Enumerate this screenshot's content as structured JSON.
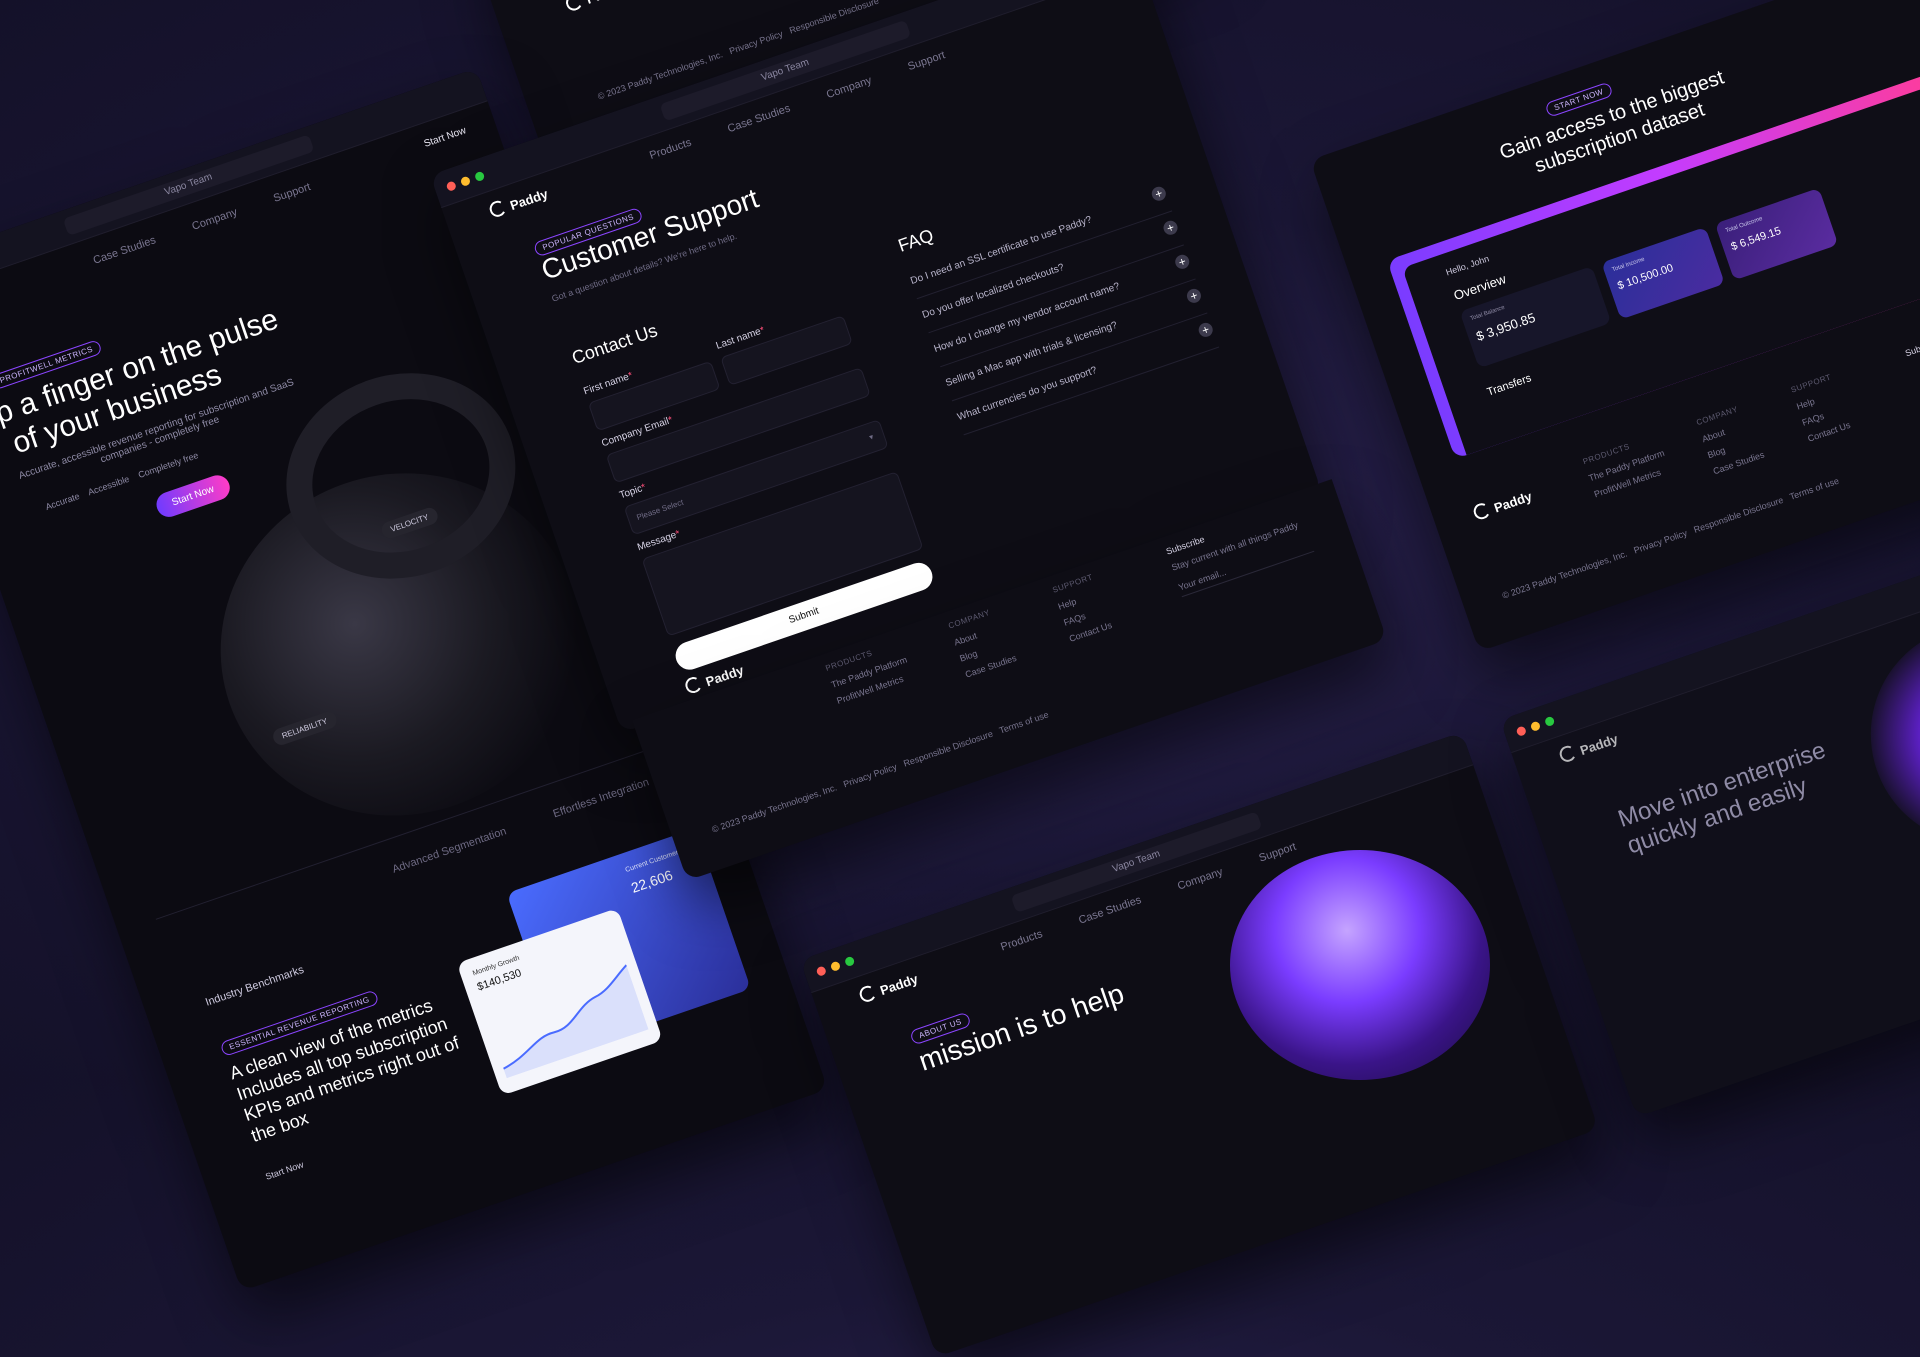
{
  "brand": {
    "name": "Paddy"
  },
  "nav": {
    "items": [
      "Products",
      "Case Studies",
      "Company",
      "Support"
    ],
    "cta": "Start Now"
  },
  "browser": {
    "url": "Vapo Team"
  },
  "support_page": {
    "tag": "POPULAR QUESTIONS",
    "title": "Customer Support",
    "subtitle": "Got a question about details? We're here to help.",
    "contact": {
      "heading": "Contact Us",
      "first_name": "First name",
      "last_name": "Last name",
      "company_email": "Company Email",
      "topic": "Topic",
      "topic_placeholder": "Please Select",
      "message": "Message",
      "submit": "Submit"
    },
    "faq": {
      "heading": "FAQ",
      "items": [
        "Do I need an SSL certificate to use Paddy?",
        "Do you offer localized checkouts?",
        "How do I change my vendor account name?",
        "Selling a Mac app with trials & licensing?",
        "What currencies do you support?"
      ]
    },
    "subscribe": {
      "title": "Subscribe",
      "subtitle": "Stay current with all things Paddy",
      "placeholder": "Your email..."
    }
  },
  "footer": {
    "products_heading": "PRODUCTS",
    "products": [
      "The Paddy Platform",
      "ProfitWell Metrics"
    ],
    "company_heading": "COMPANY",
    "company": [
      "About",
      "Blog",
      "Case Studies"
    ],
    "support_heading": "SUPPORT",
    "support": [
      "Help",
      "FAQs",
      "Contact Us"
    ],
    "copyright": "© 2023 Paddy Technologies, Inc.",
    "legal": [
      "Privacy Policy",
      "Responsible Disclosure",
      "Terms of use"
    ]
  },
  "metrics_page": {
    "tag": "PROFITWELL METRICS",
    "headline_1": "eep a finger on the pulse",
    "headline_2": "of your business",
    "sub": "Accurate, accessible revenue reporting for subscription and SaaS companies - completely free",
    "badges": [
      "Accurate",
      "Accessible",
      "Completely free"
    ],
    "cta": "Start Now",
    "chips": [
      "VELOCITY",
      "RELIABILITY"
    ],
    "tabs": [
      "Advanced Segmentation",
      "Effortless Integration"
    ],
    "benchmark": "Industry Benchmarks",
    "report_tag": "ESSENTIAL REVENUE REPORTING",
    "report_title": "A clean view of the metrics Includes all top subscription KPIs and metrics right out of the box",
    "report_cta": "Start Now",
    "card_growth_label": "Monthly Growth",
    "card_growth_value": "$140,530",
    "card_customers_label": "Current Customers",
    "card_customers_value": "22,606"
  },
  "dataset_page": {
    "tag": "START NOW",
    "title": "Gain access to the biggest subscription dataset",
    "greeting": "Hello, John",
    "overview": "Overview",
    "balance_label": "Total Balance",
    "balance_value": "$ 3,950.85",
    "income_label": "Total Income",
    "income_value": "$ 10,500.00",
    "outcome_label": "Total Outcome",
    "outcome_value": "$ 6,549.15",
    "transfers": "Transfers",
    "subscribe": "Subscribe"
  },
  "mission_page": {
    "tag": "ABOUT US",
    "headline": "mission is to help"
  },
  "enterprise_page": {
    "headline": "Move into enterprise quickly and easily"
  },
  "colors": {
    "accent": "#8b45ff",
    "accent2": "#ff3cc7",
    "bg": "#0e0d15",
    "panel": "#15141f"
  }
}
